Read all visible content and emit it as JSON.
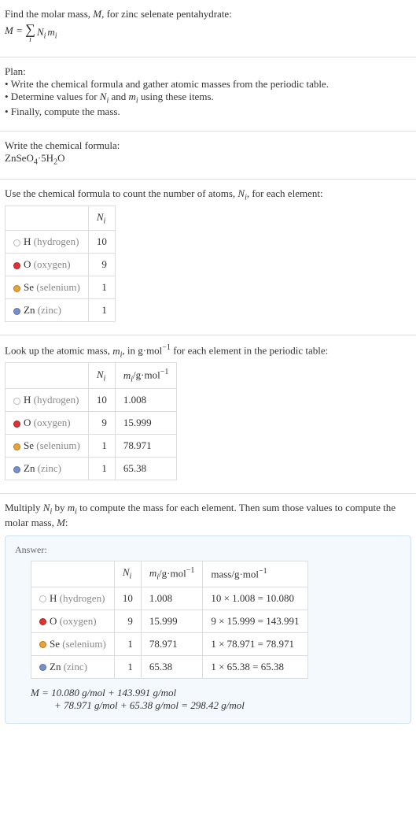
{
  "intro": {
    "line1_pre": "Find the molar mass, ",
    "line1_M": "M",
    "line1_post": ", for zinc selenate pentahydrate:",
    "eq_lhs": "M = ",
    "eq_rhs": "N",
    "eq_rhs2": "m",
    "sum_idx": "i"
  },
  "plan": {
    "title": "Plan:",
    "b1_pre": "• Write the chemical formula and gather atomic masses from the periodic table.",
    "b2_pre": "• Determine values for ",
    "b2_Ni": "N",
    "b2_mid": " and ",
    "b2_mi": "m",
    "b2_post": " using these items.",
    "b3": "• Finally, compute the mass."
  },
  "formula": {
    "title": "Write the chemical formula:",
    "text_pre": "ZnSeO",
    "sub4": "4",
    "mid": "·5H",
    "sub2": "2",
    "post": "O"
  },
  "count": {
    "title_pre": "Use the chemical formula to count the number of atoms, ",
    "title_Ni": "N",
    "title_post": ", for each element:",
    "header": "N",
    "rows": [
      {
        "dot": "h",
        "sym": "H",
        "name": "(hydrogen)",
        "n": "10"
      },
      {
        "dot": "o",
        "sym": "O",
        "name": "(oxygen)",
        "n": "9"
      },
      {
        "dot": "se",
        "sym": "Se",
        "name": "(selenium)",
        "n": "1"
      },
      {
        "dot": "zn",
        "sym": "Zn",
        "name": "(zinc)",
        "n": "1"
      }
    ]
  },
  "mass": {
    "title_pre": "Look up the atomic mass, ",
    "title_mi": "m",
    "title_mid": ", in g·mol",
    "title_exp": "−1",
    "title_post": " for each element in the periodic table:",
    "h1": "N",
    "h2_pre": "m",
    "h2_unit": "/g·mol",
    "h2_exp": "−1",
    "rows": [
      {
        "dot": "h",
        "sym": "H",
        "name": "(hydrogen)",
        "n": "10",
        "m": "1.008"
      },
      {
        "dot": "o",
        "sym": "O",
        "name": "(oxygen)",
        "n": "9",
        "m": "15.999"
      },
      {
        "dot": "se",
        "sym": "Se",
        "name": "(selenium)",
        "n": "1",
        "m": "78.971"
      },
      {
        "dot": "zn",
        "sym": "Zn",
        "name": "(zinc)",
        "n": "1",
        "m": "65.38"
      }
    ]
  },
  "multiply": {
    "text_pre": "Multiply ",
    "Ni": "N",
    "mid1": " by ",
    "mi": "m",
    "mid2": " to compute the mass for each element. Then sum those values to compute the molar mass, ",
    "M": "M",
    "post": ":"
  },
  "answer": {
    "label": "Answer:",
    "h1": "N",
    "h2_pre": "m",
    "h2_unit": "/g·mol",
    "h2_exp": "−1",
    "h3_pre": "mass/g·mol",
    "h3_exp": "−1",
    "rows": [
      {
        "dot": "h",
        "sym": "H",
        "name": "(hydrogen)",
        "n": "10",
        "m": "1.008",
        "calc": "10 × 1.008 = 10.080"
      },
      {
        "dot": "o",
        "sym": "O",
        "name": "(oxygen)",
        "n": "9",
        "m": "15.999",
        "calc": "9 × 15.999 = 143.991"
      },
      {
        "dot": "se",
        "sym": "Se",
        "name": "(selenium)",
        "n": "1",
        "m": "78.971",
        "calc": "1 × 78.971 = 78.971"
      },
      {
        "dot": "zn",
        "sym": "Zn",
        "name": "(zinc)",
        "n": "1",
        "m": "65.38",
        "calc": "1 × 65.38 = 65.38"
      }
    ],
    "final_l1": "M = 10.080 g/mol + 143.991 g/mol",
    "final_l2": "+ 78.971 g/mol + 65.38 g/mol = 298.42 g/mol"
  },
  "chart_data": {
    "type": "table",
    "title": "Molar mass of zinc selenate pentahydrate ZnSeO4·5H2O",
    "elements": [
      {
        "element": "H",
        "name": "hydrogen",
        "N_i": 10,
        "m_i_g_per_mol": 1.008,
        "mass_g_per_mol": 10.08
      },
      {
        "element": "O",
        "name": "oxygen",
        "N_i": 9,
        "m_i_g_per_mol": 15.999,
        "mass_g_per_mol": 143.991
      },
      {
        "element": "Se",
        "name": "selenium",
        "N_i": 1,
        "m_i_g_per_mol": 78.971,
        "mass_g_per_mol": 78.971
      },
      {
        "element": "Zn",
        "name": "zinc",
        "N_i": 1,
        "m_i_g_per_mol": 65.38,
        "mass_g_per_mol": 65.38
      }
    ],
    "molar_mass_g_per_mol": 298.42
  }
}
